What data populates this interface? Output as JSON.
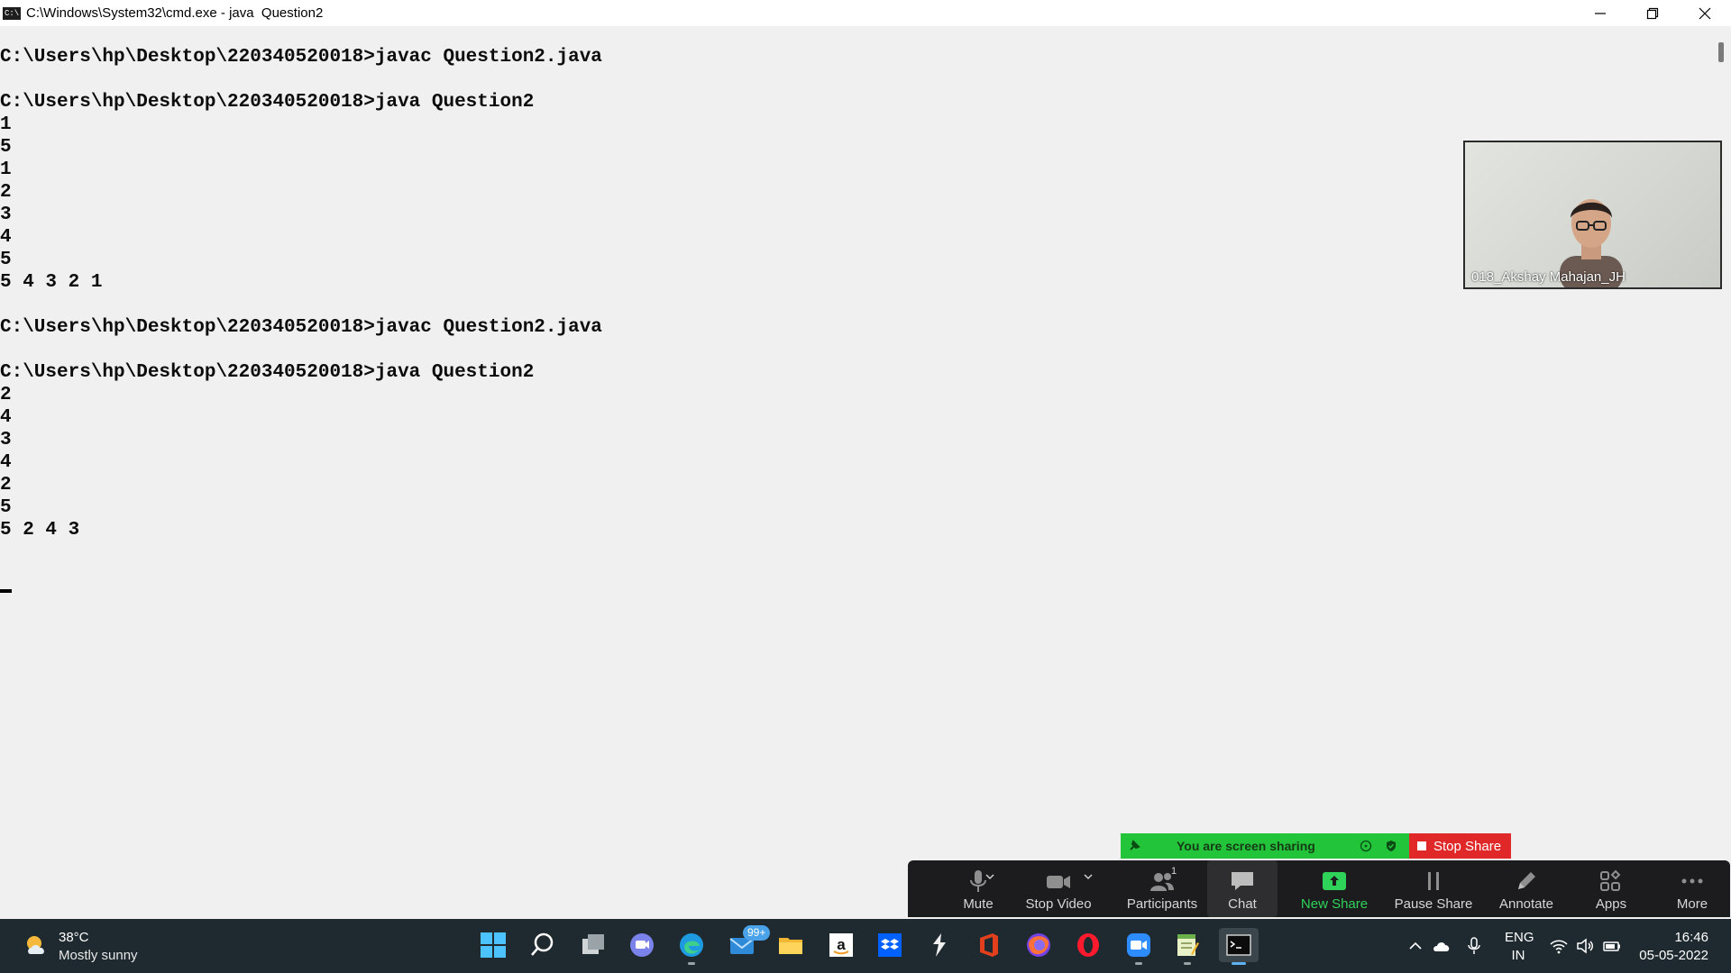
{
  "window": {
    "title": "C:\\Windows\\System32\\cmd.exe - java  Question2",
    "icon_label": "C:\\",
    "controls": [
      "minimize-icon",
      "restore-icon",
      "close-icon"
    ]
  },
  "console": {
    "lines": [
      "C:\\Users\\hp\\Desktop\\220340520018>javac Question2.java",
      "",
      "C:\\Users\\hp\\Desktop\\220340520018>java Question2",
      "1",
      "5",
      "1",
      "2",
      "3",
      "4",
      "5",
      "5 4 3 2 1",
      "",
      "C:\\Users\\hp\\Desktop\\220340520018>javac Question2.java",
      "",
      "C:\\Users\\hp\\Desktop\\220340520018>java Question2",
      "2",
      "4",
      "3",
      "4",
      "2",
      "5",
      "5 2 4 3"
    ]
  },
  "video": {
    "participant_name": "018_Akshay Mahajan_JH"
  },
  "share_banner": {
    "status_text": "You are screen sharing",
    "stop_label": "Stop Share",
    "colors": {
      "green": "#22c43a",
      "red": "#e02828"
    }
  },
  "zoom_toolbar": {
    "mute": "Mute",
    "stop_video": "Stop Video",
    "participants": "Participants",
    "participants_count": "1",
    "chat": "Chat",
    "new_share": "New Share",
    "pause_share": "Pause Share",
    "annotate": "Annotate",
    "apps": "Apps",
    "more": "More"
  },
  "taskbar": {
    "weather": {
      "temp": "38°C",
      "condition": "Mostly sunny",
      "icon": "sun-cloud-icon"
    },
    "apps": [
      "start-icon",
      "search-icon",
      "task-view-icon",
      "teams-chat-icon",
      "edge-icon",
      "mail-icon",
      "file-explorer-icon",
      "amazon-icon",
      "dropbox-icon",
      "app-icon",
      "office-icon",
      "firefox-icon",
      "opera-icon",
      "zoom-icon",
      "notepad-icon",
      "terminal-icon"
    ],
    "mail_badge": "99+",
    "tray": {
      "language_line1": "ENG",
      "language_line2": "IN",
      "time": "16:46",
      "date": "05-05-2022"
    }
  }
}
